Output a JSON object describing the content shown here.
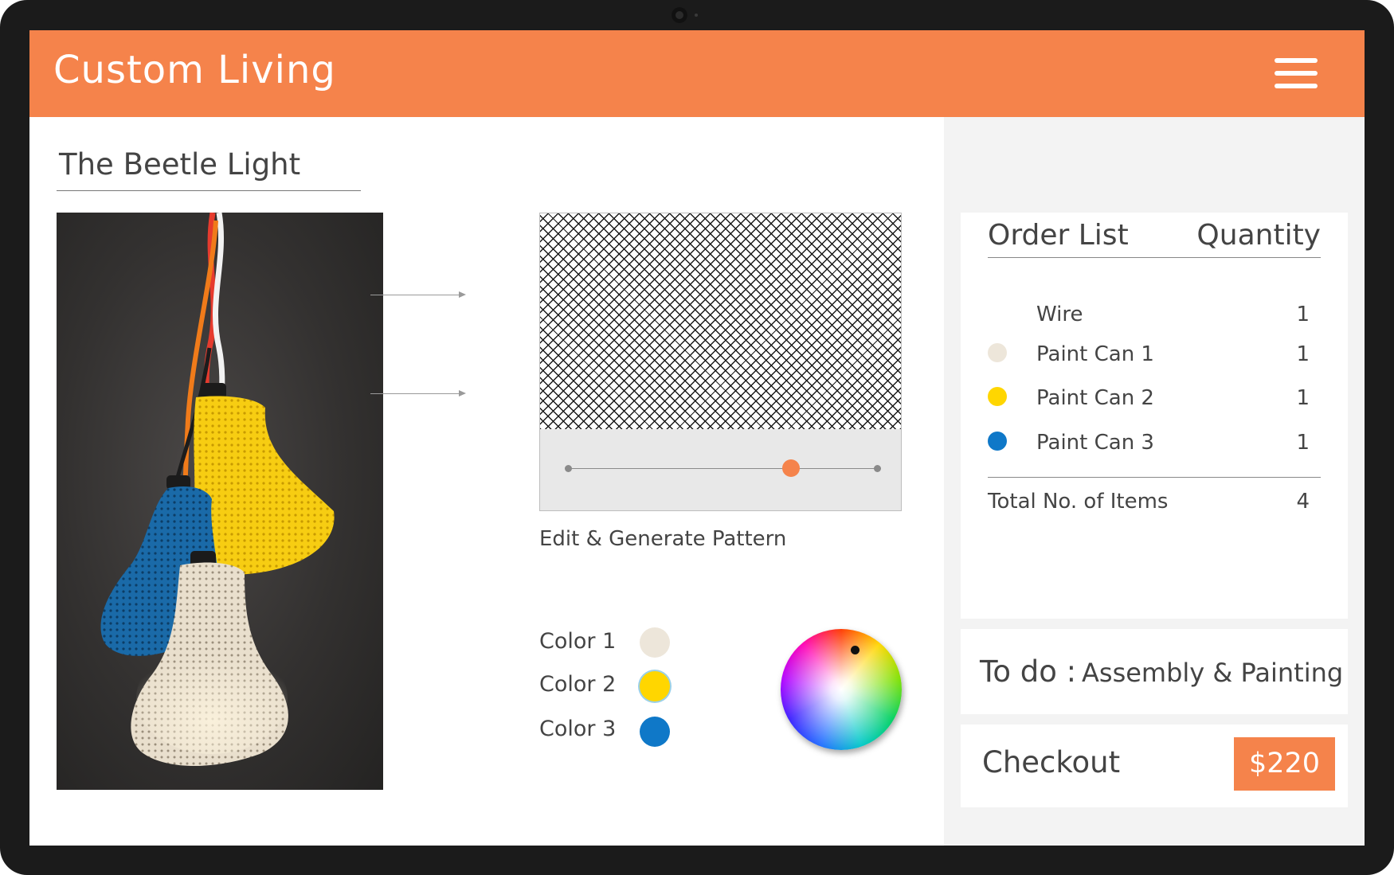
{
  "app": {
    "title": "Custom Living"
  },
  "product": {
    "title": "The Beetle Light",
    "image_alt": "Three 3D-printed pendant lamps in yellow, blue and cream"
  },
  "pattern": {
    "caption": "Edit & Generate Pattern",
    "slider_value": 0.72
  },
  "colors": [
    {
      "label": "Color 1",
      "hex": "#ede6da"
    },
    {
      "label": "Color 2",
      "hex": "#ffd600"
    },
    {
      "label": "Color 3",
      "hex": "#0f78c8"
    }
  ],
  "order": {
    "heading": "Order List",
    "qty_heading": "Quantity",
    "items": [
      {
        "name": "Wire",
        "qty": "1",
        "color": ""
      },
      {
        "name": "Paint Can 1",
        "qty": "1",
        "color": "#ede6da"
      },
      {
        "name": "Paint Can 2",
        "qty": "1",
        "color": "#ffd600"
      },
      {
        "name": "Paint Can 3",
        "qty": "1",
        "color": "#0f78c8"
      }
    ],
    "total_label": "Total No. of Items",
    "total_value": "4"
  },
  "todo": {
    "label": "To do :",
    "value": "Assembly & Painting"
  },
  "checkout": {
    "label": "Checkout",
    "price": "$220"
  },
  "theme": {
    "accent": "#f5834b",
    "panel_bg": "#f3f3f3"
  }
}
